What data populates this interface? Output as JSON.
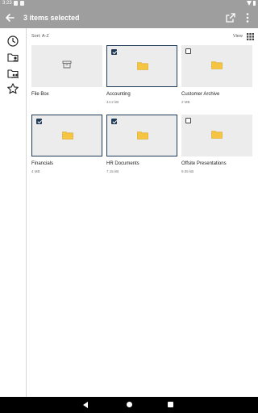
{
  "status_bar": {
    "time": "3:23"
  },
  "app_bar": {
    "title": "3 items selected",
    "back_icon": "arrow-left-icon",
    "share_icon": "share-icon",
    "more_icon": "more-vert-icon"
  },
  "side_nav": {
    "items": [
      {
        "icon": "clock-icon"
      },
      {
        "icon": "folder-user-icon"
      },
      {
        "icon": "folder-shared-icon"
      },
      {
        "icon": "star-icon"
      }
    ]
  },
  "toolbar": {
    "sort_label": "Sort: A-Z",
    "view_label": "View",
    "view_icon": "grid-icon"
  },
  "items": [
    {
      "name": "File Box",
      "size": "",
      "type": "box",
      "selectable": false,
      "selected": false
    },
    {
      "name": "Accounting",
      "size": "44.2 kB",
      "type": "folder",
      "selectable": true,
      "selected": true
    },
    {
      "name": "Customer Archive",
      "size": "2 MB",
      "type": "folder",
      "selectable": true,
      "selected": false
    },
    {
      "name": "Financials",
      "size": "4 MB",
      "type": "folder",
      "selectable": true,
      "selected": true
    },
    {
      "name": "HR Documents",
      "size": "7.15 kB",
      "type": "folder",
      "selectable": true,
      "selected": true
    },
    {
      "name": "Offsite Presentations",
      "size": "9.05 kB",
      "type": "folder",
      "selectable": true,
      "selected": false
    }
  ],
  "colors": {
    "app_bar": "#9e9e9e",
    "selection": "#1f3b57",
    "folder": "#f5c542",
    "tile": "#ececec"
  }
}
